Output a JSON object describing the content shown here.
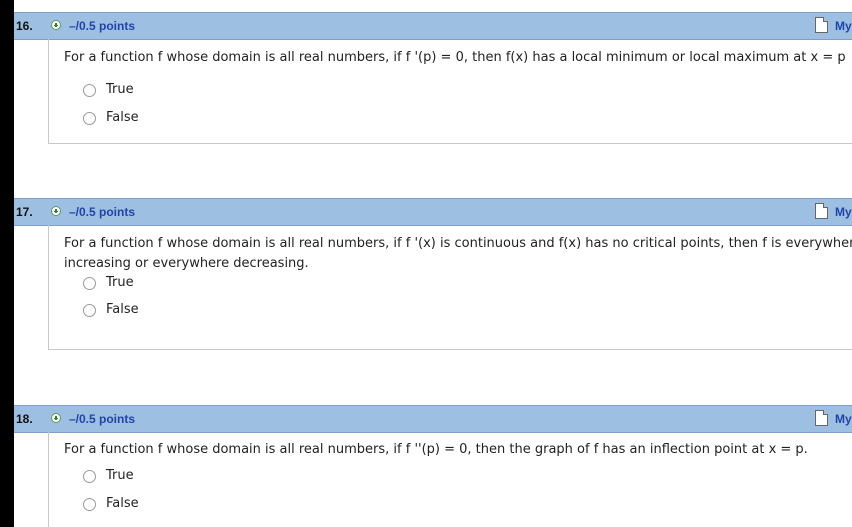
{
  "questions": [
    {
      "number": "16.",
      "points": "–/0.5 points",
      "my_link": "My",
      "text_line1": "For a function f whose domain is all real numbers, if f '(p) = 0, then f(x) has a local minimum or local maximum at x = p",
      "text_line2": "",
      "options": [
        "True",
        "False"
      ]
    },
    {
      "number": "17.",
      "points": "–/0.5 points",
      "my_link": "My",
      "text_line1": "For a function f whose domain is all real numbers, if f '(x) is continuous and f(x) has no critical points, then f is everywhere",
      "text_line2": "increasing or everywhere decreasing.",
      "options": [
        "True",
        "False"
      ]
    },
    {
      "number": "18.",
      "points": "–/0.5 points",
      "my_link": "My",
      "text_line1": "For a function f whose domain is all real numbers, if f ''(p) = 0, then the graph of f has an inflection point at x = p.",
      "text_line2": "",
      "options": [
        "True",
        "False"
      ]
    }
  ]
}
